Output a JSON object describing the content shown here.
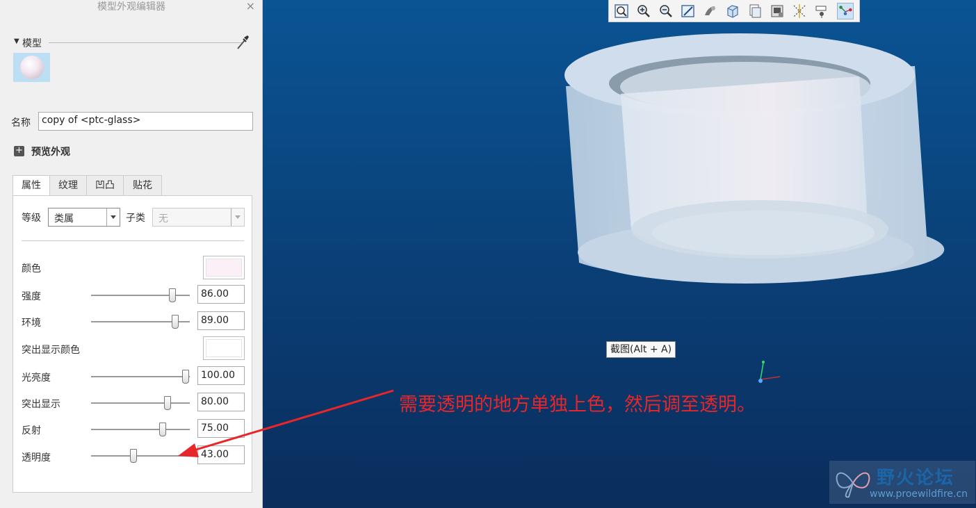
{
  "panel": {
    "title": "模型外观编辑器",
    "close_glyph": "×",
    "model_label": "模型",
    "name_label": "名称",
    "name_value": "copy of <ptc-glass>",
    "preview_label": "预览外观",
    "tabs": [
      "属性",
      "纹理",
      "凹凸",
      "贴花"
    ],
    "active_tab": "属性",
    "class_label": "等级",
    "class_value": "类属",
    "subclass_label": "子类",
    "subclass_value": "无",
    "properties": {
      "color_label": "颜色",
      "color_value": "#fbf0f8",
      "intensity_label": "强度",
      "intensity_value": "86.00",
      "ambient_label": "环境",
      "ambient_value": "89.00",
      "highlight_color_label": "突出显示颜色",
      "highlight_color_value": "#ffffff",
      "shininess_label": "光亮度",
      "shininess_value": "100.00",
      "highlight_label": "突出显示",
      "highlight_value": "80.00",
      "reflection_label": "反射",
      "reflection_value": "75.00",
      "transparency_label": "透明度",
      "transparency_value": "43.00"
    }
  },
  "viewport": {
    "toolbar_icons": [
      "refit-icon",
      "zoom-in-icon",
      "zoom-out-icon",
      "repaint-icon",
      "display-style-icon",
      "saved-orientations-icon",
      "view-manager-icon",
      "perspective-icon",
      "datum-display-icon",
      "annotation-display-icon",
      "spin-center-icon"
    ],
    "tooltip": "截图(Alt + A)",
    "annotation_text": "需要透明的地方单独上色，然后调至透明。",
    "watermark_title": "野火论坛",
    "watermark_url": "www.proewildfire.cn",
    "background_top": "#0a5494",
    "background_bottom": "#0a2d5c"
  }
}
